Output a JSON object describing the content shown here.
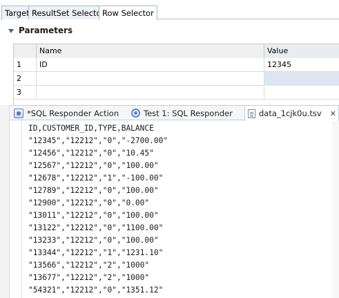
{
  "top_tabs": [
    {
      "label": "Target"
    },
    {
      "label": "ResultSet Selector"
    },
    {
      "label": "Row Selector"
    }
  ],
  "parameters": {
    "title": "Parameters",
    "columns": [
      "",
      "Name",
      "Value"
    ],
    "rows": [
      {
        "num": "1",
        "name": "ID",
        "value": "12345"
      },
      {
        "num": "2",
        "name": "",
        "value": ""
      },
      {
        "num": "3",
        "name": "",
        "value": ""
      }
    ]
  },
  "editor_tabs": [
    {
      "label": "*SQL Responder Action",
      "icon": "sql-responder-icon"
    },
    {
      "label": "Test 1: SQL Responder",
      "icon": "test-icon"
    },
    {
      "label": "data_1cjk0u.tsv",
      "icon": "file-icon",
      "close": "✕"
    }
  ],
  "file_lines": [
    "ID,CUSTOMER_ID,TYPE,BALANCE",
    "\"12345\",\"12212\",\"0\",\"-2700.00\"",
    "\"12456\",\"12212\",\"0\",\"10.45\"",
    "\"12567\",\"12212\",\"0\",\"100.00\"",
    "\"12678\",\"12212\",\"1\",\"-100.00\"",
    "\"12789\",\"12212\",\"0\",\"100.00\"",
    "\"12900\",\"12212\",\"0\",\"0.00\"",
    "\"13011\",\"12212\",\"0\",\"100.00\"",
    "\"13122\",\"12212\",\"0\",\"1100.00\"",
    "\"13233\",\"12212\",\"0\",\"100.00\"",
    "\"13344\",\"12212\",\"1\",\"1231.10\"",
    "\"13566\",\"12212\",\"2\",\"1000\"",
    "\"13677\",\"12212\",\"2\",\"1000\"",
    "\"54321\",\"12212\",\"0\",\"1351.12\""
  ]
}
